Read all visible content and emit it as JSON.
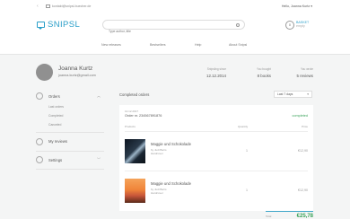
{
  "topbar": {
    "back_icon": "‹",
    "email": "kontakt@snipsl-buecher.de",
    "greeting": "Hello, Joanna Kurtz",
    "greeting_chevron": "▾"
  },
  "header": {
    "logo": "SNIPSL",
    "search_placeholder": "Type author, title",
    "basket_count": "0",
    "basket_label": "BASKET",
    "basket_sub": "empty"
  },
  "nav": [
    "New releases",
    "Bestsellers",
    "Help",
    "About Snipsl"
  ],
  "profile": {
    "name": "Joanna Kurtz",
    "email": "joanna.kurtz@gmail.com",
    "stats": [
      {
        "label": "Snipsling since",
        "value": "12.12.2014"
      },
      {
        "label": "You bought",
        "value": "8 books"
      },
      {
        "label": "You wrote",
        "value": "5 reviews"
      }
    ]
  },
  "sidebar": {
    "orders_label": "Orders",
    "orders_chevron": "︿",
    "sub_items": [
      "Last orders",
      "Completed",
      "Canceled"
    ],
    "reviews_label": "My reviews",
    "settings_label": "Settings",
    "settings_chevron": "﹀"
  },
  "main": {
    "title": "Completed orders",
    "sort_value": "Last 7 days",
    "sort_chevron": "▾"
  },
  "order": {
    "date": "12.12.2017",
    "number": "Order nr. 234567891876",
    "status": "completed",
    "col_product": "Products",
    "col_quantity": "Quantity",
    "col_price": "Price",
    "items": [
      {
        "title": "Maggie und Schokolade",
        "author": "by Judi Barrs",
        "type": "Hardcover",
        "qty": "1",
        "price": "€12,90"
      },
      {
        "title": "Maggie und Schokolade",
        "author": "by Judi Barrs",
        "type": "Hardcover",
        "qty": "1",
        "price": "€12,90"
      }
    ],
    "total_label": "Total",
    "total_value": "€25,78"
  },
  "colors": {
    "accent": "#2a9fc9",
    "success": "#3aa35a",
    "page_bg": "#f4f5f5"
  }
}
